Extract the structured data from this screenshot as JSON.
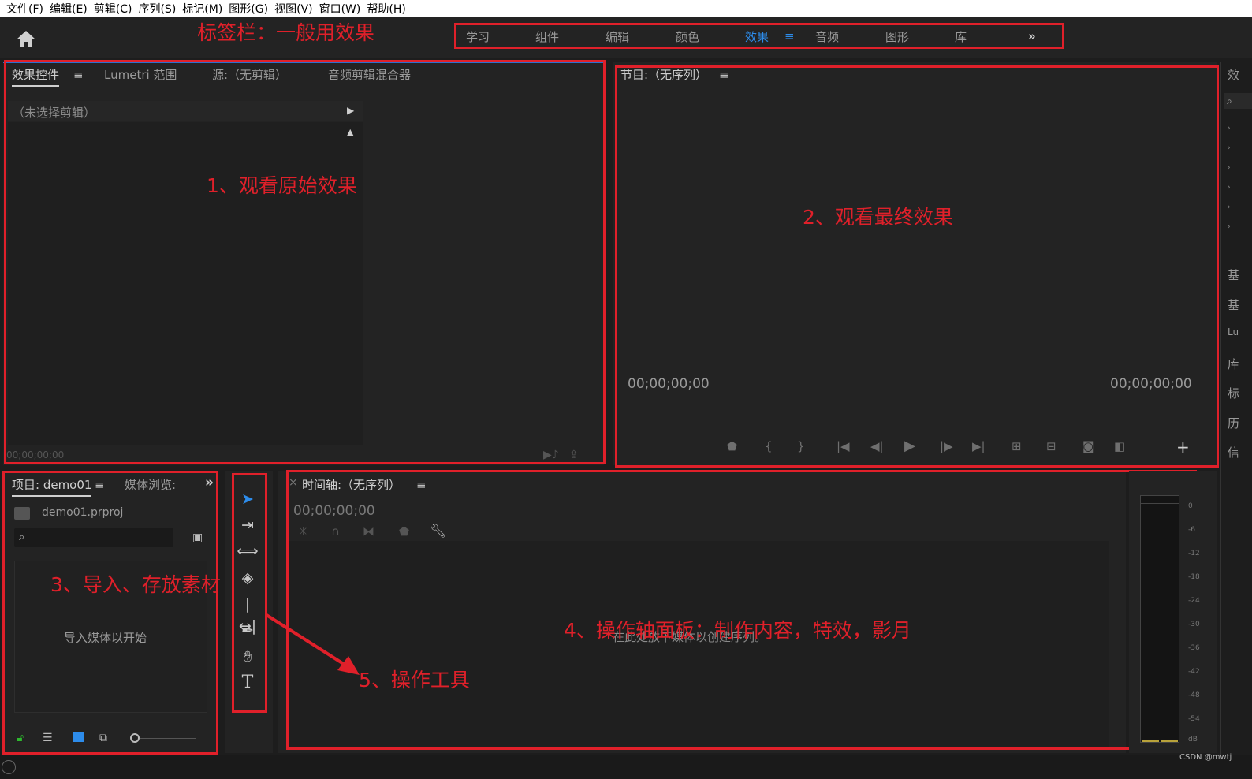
{
  "menu": [
    "文件(F)",
    "编辑(E)",
    "剪辑(C)",
    "序列(S)",
    "标记(M)",
    "图形(G)",
    "视图(V)",
    "窗口(W)",
    "帮助(H)"
  ],
  "workspaces": {
    "tabs": [
      "学习",
      "组件",
      "编辑",
      "颜色",
      "效果",
      "音频",
      "图形",
      "库"
    ],
    "active": "效果",
    "active_color": "#2d8ceb",
    "more_icon": "double-chevron-right-icon"
  },
  "source_panel": {
    "tabs": [
      "效果控件",
      "Lumetri 范围",
      "源:（无剪辑）",
      "音频剪辑混合器"
    ],
    "no_clip": "（未选择剪辑）",
    "timecode": "00;00;00;00"
  },
  "program_panel": {
    "title": "节目:（无序列）",
    "timecode_left": "00;00;00;00",
    "timecode_right": "00;00;00;00",
    "controls": [
      "marker-icon",
      "mark-in-icon",
      "mark-out-icon",
      "go-to-in-icon",
      "step-back-icon",
      "play-icon",
      "step-forward-icon",
      "go-to-out-icon",
      "lift-icon",
      "extract-icon",
      "export-frame-icon",
      "comparison-view-icon",
      "add-button-icon"
    ]
  },
  "project_panel": {
    "tabs": [
      "项目: demo01",
      "媒体浏览:"
    ],
    "file": "demo01.prproj",
    "empty_text": "导入媒体以开始"
  },
  "tools": [
    "selection-tool-icon",
    "track-select-tool-icon",
    "ripple-edit-tool-icon",
    "razor-tool-icon",
    "slip-tool-icon",
    "pen-tool-icon",
    "hand-tool-icon",
    "type-tool-icon"
  ],
  "timeline_panel": {
    "title": "时间轴:（无序列）",
    "timecode": "00;00;00;00",
    "drop_text": "在此处放下媒体以创建序列。"
  },
  "audio_meter": {
    "ticks": [
      "0",
      "-6",
      "-12",
      "-18",
      "-24",
      "-30",
      "-36",
      "-42",
      "-48",
      "-54",
      "dB"
    ]
  },
  "side_panel": {
    "letters": [
      "效",
      "基",
      "基",
      "Lu",
      "库",
      "标",
      "历",
      "信"
    ]
  },
  "annotations": {
    "tab_bar": "标签栏：一般用效果",
    "a1": "1、观看原始效果",
    "a2": "2、观看最终效果",
    "a3": "3、导入、存放素材",
    "a4": "4、操作轴面板：制作内容，特效，影月",
    "a5": "5、操作工具",
    "color": "#e0202a"
  },
  "watermark": "CSDN @mwtj"
}
